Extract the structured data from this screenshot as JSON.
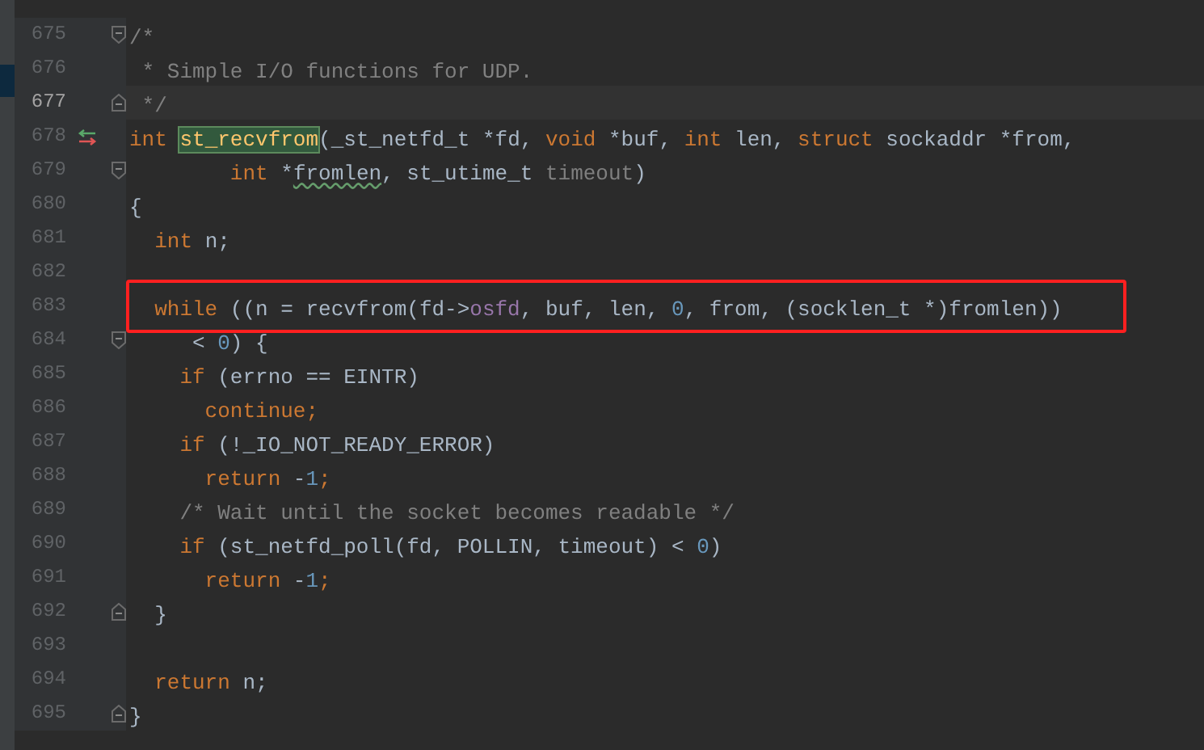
{
  "editor": {
    "lines": [
      {
        "number": "675",
        "current": false,
        "boxed": false,
        "fold_start": true,
        "fold_end": false,
        "override_marker": false,
        "tokens": [
          {
            "text": "/*",
            "kind": "comment"
          }
        ]
      },
      {
        "number": "676",
        "current": false,
        "boxed": false,
        "fold_start": false,
        "fold_end": false,
        "override_marker": false,
        "tokens": [
          {
            "text": " * Simple I/O functions for UDP.",
            "kind": "comment"
          }
        ]
      },
      {
        "number": "677",
        "current": true,
        "boxed": false,
        "fold_start": false,
        "fold_end": true,
        "override_marker": false,
        "tokens": [
          {
            "text": " */",
            "kind": "comment"
          }
        ]
      },
      {
        "number": "678",
        "current": false,
        "boxed": false,
        "fold_start": false,
        "fold_end": false,
        "override_marker": true,
        "tokens": [
          {
            "text": "int ",
            "kind": "keyword"
          },
          {
            "text": "st_recvfrom",
            "kind": "declaration"
          },
          {
            "text": "(_st_netfd_t *fd, ",
            "kind": "text"
          },
          {
            "text": "void ",
            "kind": "keyword"
          },
          {
            "text": "*buf, ",
            "kind": "text"
          },
          {
            "text": "int ",
            "kind": "keyword"
          },
          {
            "text": "len, ",
            "kind": "text"
          },
          {
            "text": "struct ",
            "kind": "keyword"
          },
          {
            "text": "sockaddr *from,",
            "kind": "text"
          }
        ]
      },
      {
        "number": "679",
        "current": false,
        "boxed": false,
        "fold_start": true,
        "fold_end": false,
        "override_marker": false,
        "tokens": [
          {
            "text": "        int ",
            "kind": "keyword"
          },
          {
            "text": "*",
            "kind": "text"
          },
          {
            "text": "fromlen",
            "kind": "typo"
          },
          {
            "text": ", st_utime_t ",
            "kind": "text"
          },
          {
            "text": "timeout",
            "kind": "unused"
          },
          {
            "text": ")",
            "kind": "text"
          }
        ]
      },
      {
        "number": "680",
        "current": false,
        "boxed": false,
        "fold_start": false,
        "fold_end": false,
        "override_marker": false,
        "tokens": [
          {
            "text": "{",
            "kind": "text"
          }
        ]
      },
      {
        "number": "681",
        "current": false,
        "boxed": false,
        "fold_start": false,
        "fold_end": false,
        "override_marker": false,
        "tokens": [
          {
            "text": "  int ",
            "kind": "keyword"
          },
          {
            "text": "n;",
            "kind": "text"
          }
        ]
      },
      {
        "number": "682",
        "current": false,
        "boxed": false,
        "fold_start": false,
        "fold_end": false,
        "override_marker": false
      },
      {
        "number": "683",
        "current": false,
        "boxed": true,
        "fold_start": false,
        "fold_end": false,
        "override_marker": false,
        "tokens": [
          {
            "text": "  while ",
            "kind": "keyword"
          },
          {
            "text": "((n = recvfrom(fd->",
            "kind": "text"
          },
          {
            "text": "osfd",
            "kind": "field"
          },
          {
            "text": ", buf, len, ",
            "kind": "text"
          },
          {
            "text": "0",
            "kind": "number"
          },
          {
            "text": ", from, (socklen_t *)fromlen))",
            "kind": "text"
          }
        ]
      },
      {
        "number": "684",
        "current": false,
        "boxed": false,
        "fold_start": true,
        "fold_end": false,
        "override_marker": false,
        "tokens": [
          {
            "text": "     < ",
            "kind": "text"
          },
          {
            "text": "0",
            "kind": "number"
          },
          {
            "text": ") {",
            "kind": "text"
          }
        ]
      },
      {
        "number": "685",
        "current": false,
        "boxed": false,
        "fold_start": false,
        "fold_end": false,
        "override_marker": false,
        "tokens": [
          {
            "text": "    if ",
            "kind": "keyword"
          },
          {
            "text": "(errno == EINTR)",
            "kind": "text"
          }
        ]
      },
      {
        "number": "686",
        "current": false,
        "boxed": false,
        "fold_start": false,
        "fold_end": false,
        "override_marker": false,
        "tokens": [
          {
            "text": "      continue;",
            "kind": "keyword"
          }
        ]
      },
      {
        "number": "687",
        "current": false,
        "boxed": false,
        "fold_start": false,
        "fold_end": false,
        "override_marker": false,
        "tokens": [
          {
            "text": "    if ",
            "kind": "keyword"
          },
          {
            "text": "(!_IO_NOT_READY_ERROR)",
            "kind": "text"
          }
        ]
      },
      {
        "number": "688",
        "current": false,
        "boxed": false,
        "fold_start": false,
        "fold_end": false,
        "override_marker": false,
        "tokens": [
          {
            "text": "      return ",
            "kind": "keyword"
          },
          {
            "text": "-",
            "kind": "text"
          },
          {
            "text": "1",
            "kind": "number"
          },
          {
            "text": ";",
            "kind": "keyword"
          }
        ]
      },
      {
        "number": "689",
        "current": false,
        "boxed": false,
        "fold_start": false,
        "fold_end": false,
        "override_marker": false,
        "tokens": [
          {
            "text": "    /* Wait until the socket becomes readable */",
            "kind": "comment"
          }
        ]
      },
      {
        "number": "690",
        "current": false,
        "boxed": false,
        "fold_start": false,
        "fold_end": false,
        "override_marker": false,
        "tokens": [
          {
            "text": "    if ",
            "kind": "keyword"
          },
          {
            "text": "(st_netfd_poll(fd, POLLIN, timeout) < ",
            "kind": "text"
          },
          {
            "text": "0",
            "kind": "number"
          },
          {
            "text": ")",
            "kind": "text"
          }
        ]
      },
      {
        "number": "691",
        "current": false,
        "boxed": false,
        "fold_start": false,
        "fold_end": false,
        "override_marker": false,
        "tokens": [
          {
            "text": "      return ",
            "kind": "keyword"
          },
          {
            "text": "-",
            "kind": "text"
          },
          {
            "text": "1",
            "kind": "number"
          },
          {
            "text": ";",
            "kind": "keyword"
          }
        ]
      },
      {
        "number": "692",
        "current": false,
        "boxed": false,
        "fold_start": false,
        "fold_end": true,
        "override_marker": false,
        "tokens": [
          {
            "text": "  }",
            "kind": "text"
          }
        ]
      },
      {
        "number": "693",
        "current": false,
        "boxed": false,
        "fold_start": false,
        "fold_end": false,
        "override_marker": false
      },
      {
        "number": "694",
        "current": false,
        "boxed": false,
        "fold_start": false,
        "fold_end": false,
        "override_marker": false,
        "tokens": [
          {
            "text": "  return ",
            "kind": "keyword"
          },
          {
            "text": "n;",
            "kind": "text"
          }
        ]
      },
      {
        "number": "695",
        "current": false,
        "boxed": false,
        "fold_start": false,
        "fold_end": true,
        "override_marker": false,
        "tokens": [
          {
            "text": "}",
            "kind": "text"
          }
        ]
      }
    ]
  }
}
